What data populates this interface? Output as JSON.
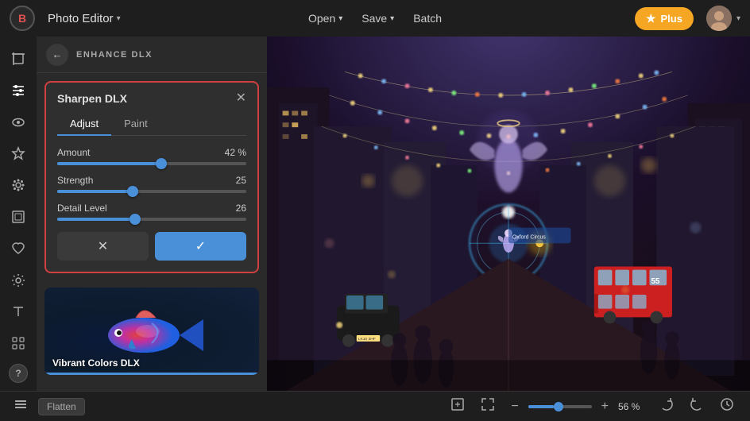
{
  "app": {
    "logo": "B",
    "title": "Photo Editor",
    "title_chevron": "▾"
  },
  "topbar": {
    "open_label": "Open",
    "save_label": "Save",
    "batch_label": "Batch",
    "chevron": "▾",
    "plus_label": "Plus",
    "star": "★"
  },
  "panel": {
    "back_icon": "←",
    "header_title": "ENHANCE DLX"
  },
  "sharpen_card": {
    "title": "Sharpen DLX",
    "close_icon": "✕",
    "tab_adjust": "Adjust",
    "tab_paint": "Paint",
    "sliders": [
      {
        "label": "Amount",
        "value": "42 %",
        "percent": 55
      },
      {
        "label": "Strength",
        "value": "25",
        "percent": 40
      },
      {
        "label": "Detail Level",
        "value": "26",
        "percent": 41
      }
    ],
    "cancel_icon": "✕",
    "confirm_icon": "✓"
  },
  "thumbnail": {
    "label": "Vibrant Colors DLX",
    "emoji": "🐠"
  },
  "bottom_bar": {
    "flatten_label": "Flatten",
    "zoom_value": "56 %",
    "minus": "−",
    "plus": "+"
  },
  "icons": {
    "layers": "⊞",
    "crop": "⊡",
    "eye": "◎",
    "star": "☆",
    "effects": "❋",
    "frame": "▭",
    "heart": "♡",
    "settings": "⚙",
    "text": "A",
    "texture": "▦",
    "help": "?",
    "back_arrow": "←",
    "resize": "⤢",
    "expand": "⤡",
    "rotate_right": "↻",
    "undo": "↺",
    "history": "⏱"
  }
}
